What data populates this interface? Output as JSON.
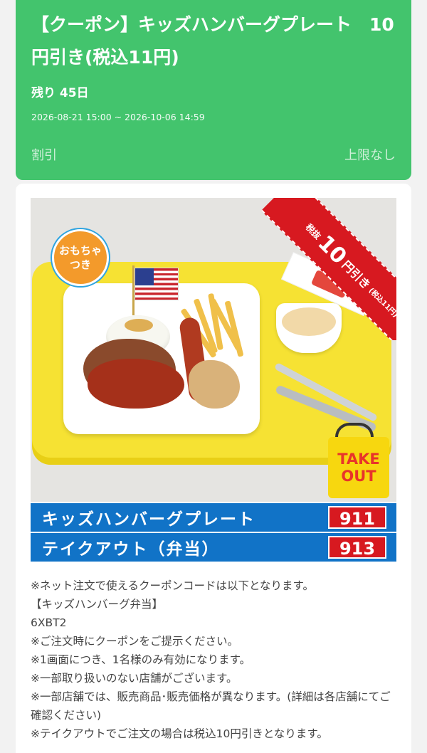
{
  "header": {
    "title": "【クーポン】キッズハンバーグプレート　10円引き(税込11円)",
    "remaining": "残り 45日",
    "period": "2026-08-21 15:00 ~ 2026-10-06 14:59",
    "discount_label": "割引",
    "limit_label": "上限なし",
    "bg_color": "#43c46d"
  },
  "image": {
    "toy_badge_line1": "おもちゃ",
    "toy_badge_line2": "つき",
    "ribbon_prefix": "税抜",
    "ribbon_amount": "10",
    "ribbon_suffix": "円引き",
    "ribbon_tax": "(税込11円)",
    "takeout_line1": "TAKE",
    "takeout_line2": "OUT"
  },
  "menu": [
    {
      "name": "キッズハンバーグプレート",
      "code": "911"
    },
    {
      "name": "テイクアウト（弁当）",
      "code": "913"
    }
  ],
  "notes": [
    "※ネット注文で使えるクーポンコードは以下となります。",
    "【キッズハンバーグ弁当】",
    "6XBT2",
    "※ご注文時にクーポンをご提示ください。",
    "※1画面につき、1名様のみ有効になります。",
    "※一部取り扱いのない店舗がございます。",
    "※一部店舗では、販売商品･販売価格が異なります。(詳細は各店舗にてご確認ください)",
    "※テイクアウトでご注文の場合は税込10円引きとなります。"
  ]
}
